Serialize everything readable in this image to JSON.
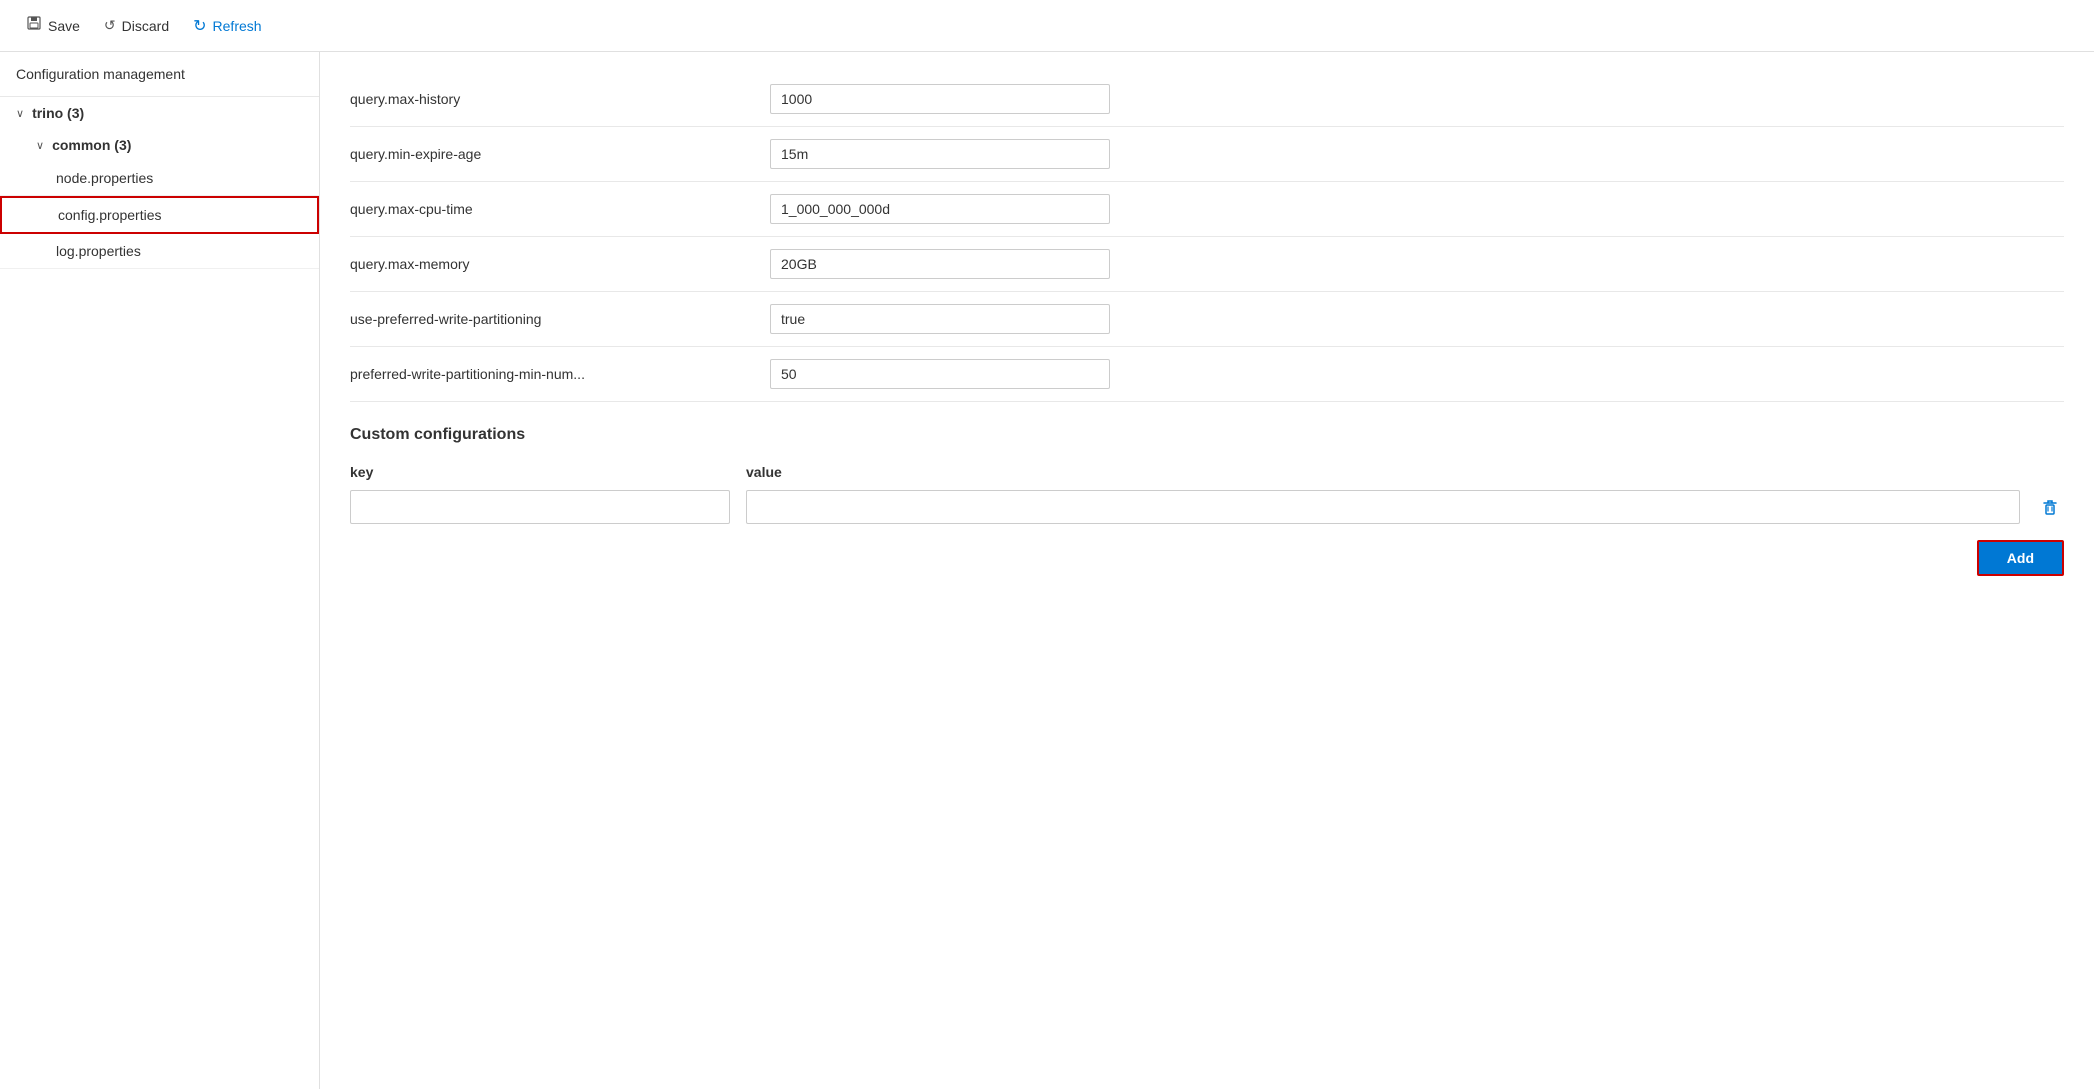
{
  "toolbar": {
    "save_label": "Save",
    "discard_label": "Discard",
    "refresh_label": "Refresh"
  },
  "sidebar": {
    "header": "Configuration management",
    "tree": {
      "trino_label": "trino (3)",
      "common_label": "common (3)",
      "leaves": [
        {
          "label": "node.properties",
          "active": false
        },
        {
          "label": "config.properties",
          "active": true
        },
        {
          "label": "log.properties",
          "active": false
        }
      ]
    }
  },
  "config_rows": [
    {
      "label": "query.max-history",
      "value": "1000"
    },
    {
      "label": "query.min-expire-age",
      "value": "15m"
    },
    {
      "label": "query.max-cpu-time",
      "value": "1_000_000_000d"
    },
    {
      "label": "query.max-memory",
      "value": "20GB"
    },
    {
      "label": "use-preferred-write-partitioning",
      "value": "true"
    },
    {
      "label": "preferred-write-partitioning-min-num...",
      "value": "50"
    }
  ],
  "custom_configs": {
    "section_title": "Custom configurations",
    "key_header": "key",
    "value_header": "value",
    "rows": [
      {
        "key": "",
        "value": ""
      }
    ]
  },
  "add_button_label": "Add",
  "icons": {
    "save": "💾",
    "discard": "↺",
    "refresh": "↻",
    "delete": "🗑",
    "chevron_down": "∨"
  }
}
